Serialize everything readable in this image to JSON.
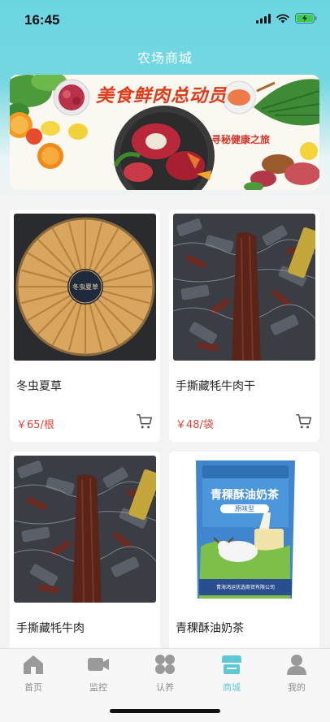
{
  "status": {
    "time": "16:45"
  },
  "header": {
    "title": "农场商城"
  },
  "banner": {
    "headline": "美食鲜肉总动员",
    "tagline": "寻秘健康之旅",
    "box_label": "冬虫夏草"
  },
  "products": [
    {
      "name": "冬虫夏草",
      "price": "￥65/根"
    },
    {
      "name": "手撕藏牦牛肉干",
      "price": "￥48/袋"
    },
    {
      "name": "手撕藏牦牛肉"
    },
    {
      "name": "青稞酥油奶茶",
      "package": {
        "title": "青稞酥油奶茶",
        "flavor": "原味型",
        "company": "青海鸿运优选商贸有限公司"
      }
    }
  ],
  "tabbar": {
    "items": [
      {
        "label": "首页",
        "icon": "home-icon"
      },
      {
        "label": "监控",
        "icon": "video-camera-icon"
      },
      {
        "label": "认养",
        "icon": "grid-icon"
      },
      {
        "label": "商城",
        "icon": "store-icon",
        "active": true
      },
      {
        "label": "我的",
        "icon": "person-icon"
      }
    ]
  },
  "colors": {
    "accent": "#5dc8d6",
    "header": "#6bd6e2",
    "price": "#e0443a"
  }
}
